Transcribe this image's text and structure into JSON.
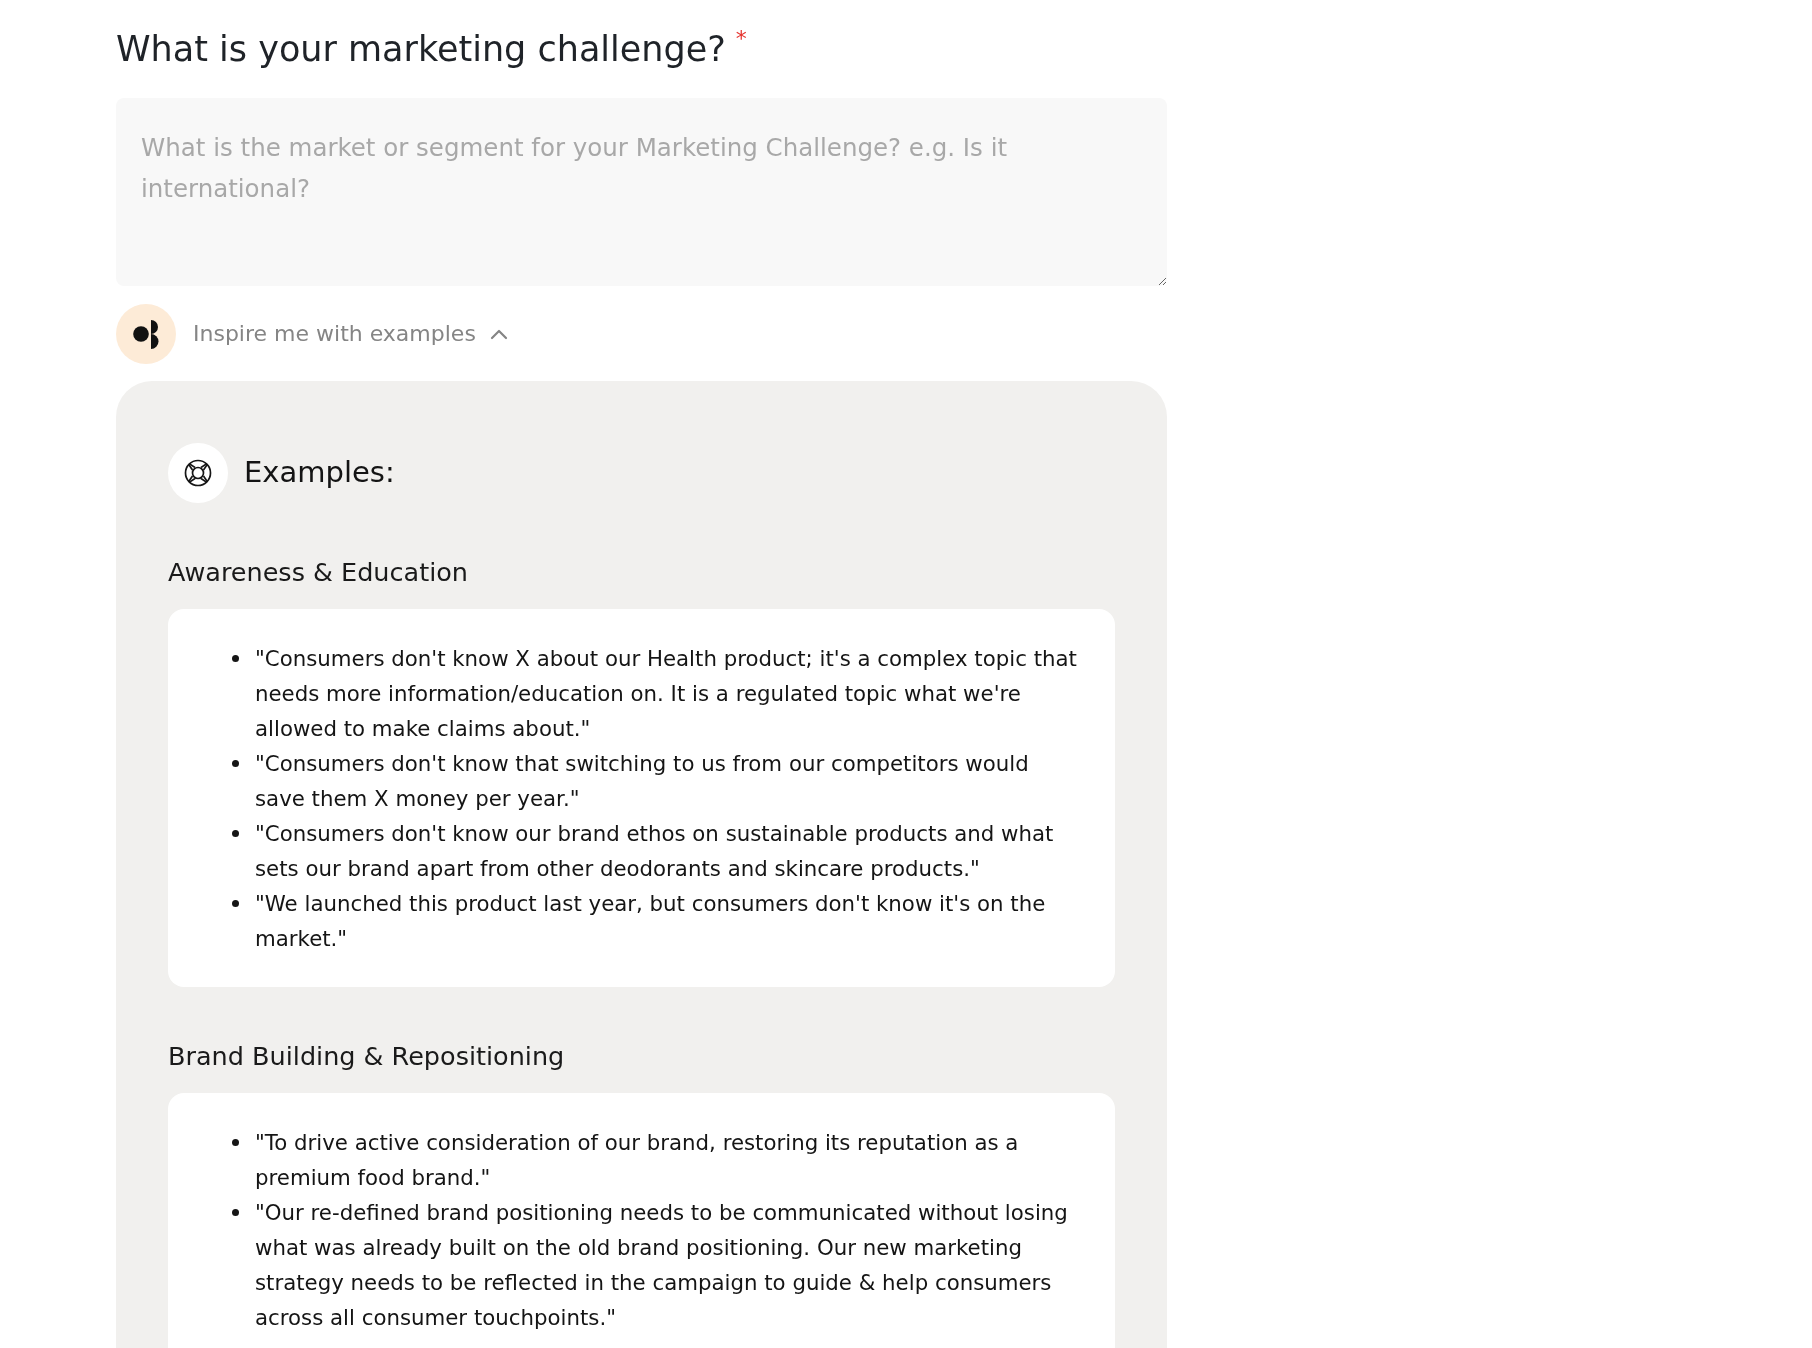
{
  "question": {
    "title": "What is your marketing challenge?",
    "required_marker": "*"
  },
  "answer": {
    "placeholder": "What is the market or segment for your Marketing Challenge? e.g. Is it international?"
  },
  "inspire_toggle": {
    "label": "Inspire me with examples",
    "expanded": true
  },
  "examples_panel": {
    "title": "Examples:",
    "sections": [
      {
        "heading": "Awareness & Education",
        "items": [
          "\"Consumers don't know X about our Health product; it's a complex topic that needs more information/education on. It is a regulated topic what we're allowed to make claims about.\"",
          "\"Consumers don't know that switching to us from our competitors would save them X money per year.\"",
          "\"Consumers don't know our brand ethos on sustainable products and what sets our brand apart from other deodorants and skincare products.\"",
          "\"We launched this product last year, but consumers don't know it's on the market.\""
        ]
      },
      {
        "heading": "Brand Building & Repositioning",
        "items": [
          "\"To drive active consideration of our brand, restoring its reputation as a premium food brand.\"",
          "\"Our re-defined brand positioning needs to be communicated without losing what was already built on the old brand positioning. Our new marketing strategy needs to be reflected in the campaign to guide & help consumers across all consumer touchpoints.\""
        ]
      }
    ]
  }
}
